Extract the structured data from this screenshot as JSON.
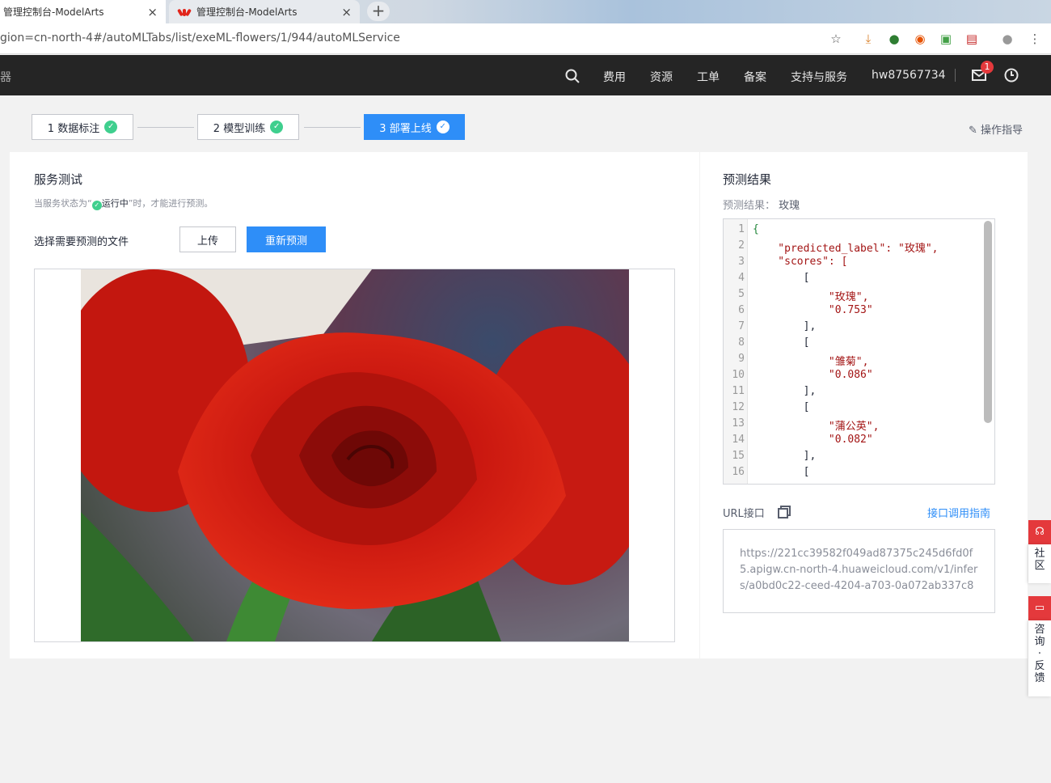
{
  "browser": {
    "tabs": [
      {
        "title": "管理控制台-ModelArts",
        "active": true
      },
      {
        "title": "管理控制台-ModelArts",
        "active": false
      }
    ],
    "new_tab": "+",
    "close": "×",
    "url": "gion=cn-north-4#/autoMLTabs/list/exeML-flowers/1/944/autoMLService"
  },
  "topnav": {
    "items": [
      "费用",
      "资源",
      "工单",
      "备案",
      "支持与服务"
    ],
    "user": "hw87567734",
    "badge": "1",
    "left_fragment": "器"
  },
  "steps": [
    {
      "label": "1 数据标注",
      "active": false
    },
    {
      "label": "2 模型训练",
      "active": false
    },
    {
      "label": "3 部署上线",
      "active": true
    }
  ],
  "guide_link": "操作指导",
  "service_test": {
    "title": "服务测试",
    "hint_prefix": "当服务状态为“",
    "hint_status": "运行中",
    "hint_suffix": "”时，才能进行预测。",
    "select_label": "选择需要预测的文件",
    "upload_button": "上传",
    "predict_button": "重新预测"
  },
  "prediction": {
    "title": "预测结果",
    "result_label": "预测结果：",
    "result_value": "玫瑰",
    "code_lines": [
      "{",
      "    \"predicted_label\": \"玫瑰\",",
      "    \"scores\": [",
      "        [",
      "            \"玫瑰\",",
      "            \"0.753\"",
      "        ],",
      "        [",
      "            \"雏菊\",",
      "            \"0.086\"",
      "        ],",
      "        [",
      "            \"蒲公英\",",
      "            \"0.082\"",
      "        ],",
      "        ["
    ],
    "url_label": "URL接口",
    "api_guide": "接口调用指南",
    "url_value": "https://221cc39582f049ad87375c245d6fd0f5.apigw.cn-north-4.huaweicloud.com/v1/infers/a0bd0c22-ceed-4204-a703-0a072ab337c8"
  },
  "float_widgets": {
    "community": "社区",
    "feedback": "咨询·反馈"
  },
  "colors": {
    "primary": "#2e8ef8",
    "success": "#3fcf8e",
    "header": "#252525",
    "alert": "#e4393c"
  }
}
